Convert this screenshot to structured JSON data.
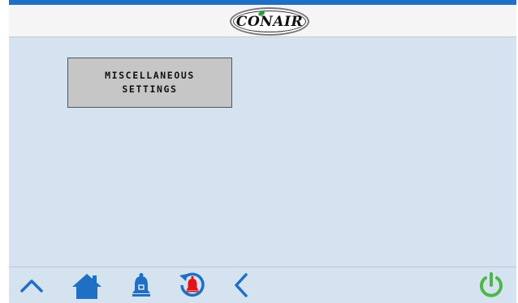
{
  "header": {
    "brand_logo_text": "CONAIR"
  },
  "main": {
    "misc_button": {
      "line1": "MISCELLANEOUS",
      "line2": "SETTINGS"
    }
  },
  "footer": {
    "icons": [
      "chevron-up-icon",
      "home-icon",
      "bell-icon",
      "alarm-history-icon",
      "back-chevron-icon",
      "power-icon"
    ]
  },
  "colors": {
    "accent_blue": "#1f6fc4",
    "panel_background": "#d5e3f0",
    "alarm_red": "#e0141b",
    "power_green": "#4cb848"
  }
}
